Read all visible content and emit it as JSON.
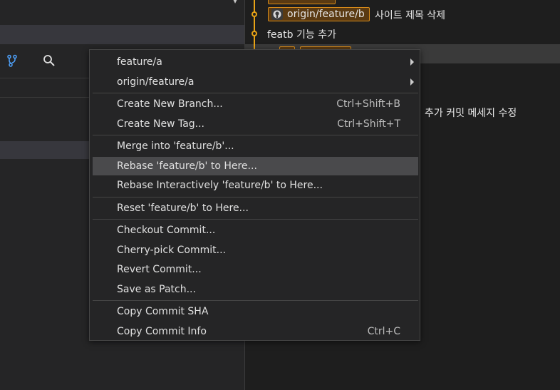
{
  "graph": {
    "commits": [
      {
        "ref": "origin/feature/b",
        "message": "사이트 제목 삭제"
      },
      {
        "ref": "",
        "message": "featb 기능 추가"
      },
      {
        "ref": "",
        "message": "추가 커밋 메세지 수정"
      }
    ]
  },
  "left_toolbar": {
    "icons": [
      "branch-icon",
      "search-icon"
    ]
  },
  "context_menu": {
    "groups": [
      [
        {
          "label": "feature/a",
          "shortcut": "",
          "submenu": true
        },
        {
          "label": "origin/feature/a",
          "shortcut": "",
          "submenu": true
        }
      ],
      [
        {
          "label": "Create New Branch...",
          "shortcut": "Ctrl+Shift+B",
          "submenu": false
        },
        {
          "label": "Create New Tag...",
          "shortcut": "Ctrl+Shift+T",
          "submenu": false
        }
      ],
      [
        {
          "label": "Merge into 'feature/b'...",
          "shortcut": "",
          "submenu": false
        },
        {
          "label": "Rebase 'feature/b' to Here...",
          "shortcut": "",
          "submenu": false,
          "highlighted": true
        },
        {
          "label": "Rebase Interactively 'feature/b' to Here...",
          "shortcut": "",
          "submenu": false
        }
      ],
      [
        {
          "label": "Reset 'feature/b' to Here...",
          "shortcut": "",
          "submenu": false
        }
      ],
      [
        {
          "label": "Checkout Commit...",
          "shortcut": "",
          "submenu": false
        },
        {
          "label": "Cherry-pick Commit...",
          "shortcut": "",
          "submenu": false
        },
        {
          "label": "Revert Commit...",
          "shortcut": "",
          "submenu": false
        },
        {
          "label": "Save as Patch...",
          "shortcut": "",
          "submenu": false
        }
      ],
      [
        {
          "label": "Copy Commit SHA",
          "shortcut": "",
          "submenu": false
        },
        {
          "label": "Copy Commit Info",
          "shortcut": "Ctrl+C",
          "submenu": false
        }
      ]
    ]
  },
  "colors": {
    "accent": "#e8a317",
    "ref_background": "#5a3a12",
    "branch_icon": "#4fa3ff"
  }
}
